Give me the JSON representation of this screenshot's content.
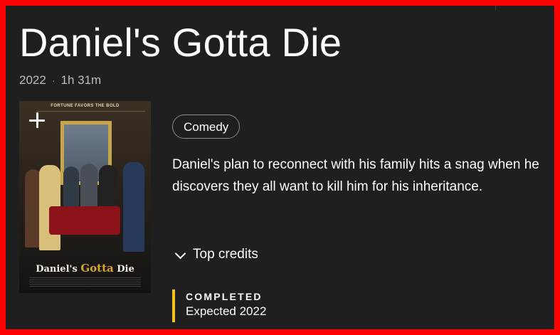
{
  "title": {
    "text": "Daniel's Gotta Die"
  },
  "meta": {
    "year": "2022",
    "separator": "·",
    "runtime": "1h 31m"
  },
  "poster": {
    "tagline": "FORTUNE FAVORS THE BOLD",
    "title_part1": "Daniel's ",
    "title_part2": "Gotta",
    "title_part3": " Die",
    "add_icon": "plus-icon"
  },
  "genres": [
    {
      "label": "Comedy"
    }
  ],
  "description": "Daniel's plan to reconnect with his family hits a snag when he discovers they all want to kill him for his inheritance.",
  "credits_toggle": {
    "label": "Top credits",
    "icon": "chevron-down-icon"
  },
  "status": {
    "label": "COMPLETED",
    "detail": "Expected 2022",
    "accent_color": "#f2c21b"
  },
  "colors": {
    "border": "#ff0000",
    "background": "#1f1f1f",
    "text": "#ffffff",
    "muted_text": "#bdbdbd"
  }
}
